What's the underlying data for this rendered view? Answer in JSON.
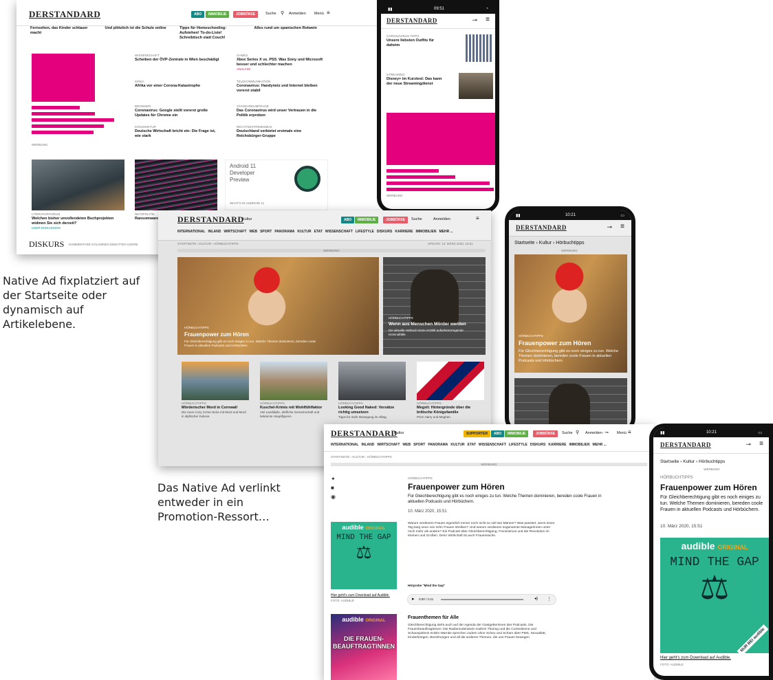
{
  "shot1": {
    "logo": "DERSTANDARD",
    "btn_abo": "ABO",
    "btn_immo": "IMMOBILIE",
    "btn_jobs": "JOBBÖRSE",
    "suche": "Suche",
    "anmelden": "Anmelden",
    "menu": "Menü",
    "top_row": [
      "Fernsehen, das Kinder schlauer macht",
      "Und plötzlich ist die Schule online",
      "Tipps für Homeschooling: Aufstehen! To-do-Liste! Schreibtisch statt Couch!",
      "Alles rund um spanischen Rotwein"
    ],
    "werbung": "WERBUNG",
    "mid_col1": [
      {
        "kicker": "WISSENSCHAFT",
        "title": "Scheiben der ÖVP-Zentrale in Wien beschädigt"
      },
      {
        "kicker": "KENIA",
        "title": "Afrika vor einer Corona-Katastrophe"
      },
      {
        "kicker": "BROWSER",
        "title": "Coronavirus: Google stellt vorerst große Updates für Chrome ein"
      },
      {
        "kicker": "KONJUNKTUR",
        "title": "Deutsche Wirtschaft bricht ein: Die Frage ist, wie stark"
      }
    ],
    "mid_col2": [
      {
        "kicker": "GAMES",
        "title": "Xbox Series X vs. PS5: Was Sony und Microsoft besser und schlechter machen",
        "extra": "ANALYSE"
      },
      {
        "kicker": "TELEKOMMUNIKATION",
        "title": "Coronavirus: Handynetz und Internet bleiben vorerst stabil"
      },
      {
        "kicker": "STANDARDUMFRAGE",
        "title": "Das Coronavirus wird unser Vertrauen in die Politik erproben"
      },
      {
        "kicker": "RECHTSEXTREMISMUS",
        "title": "Deutschland verbietet erstmals eine Reichsbürger-Gruppe"
      }
    ],
    "bottom_kicker1": "LITERATURFORUM",
    "bottom_title1": "Welchen bisher unvollendeten Buchprojekten widmen Sie sich derzeit?",
    "bottom_link1": "USER-DISKUSSION",
    "bottom_kicker2": "NETZPOLITIK",
    "bottom_title2": "Ransomware vorerst vers",
    "android_title": "Android 11 Developer Preview",
    "android_sub": "What's in Android 11",
    "diskurs": "DISKURS",
    "diskurs_links": "KOMMENTARE   KOLUMNEN   DEBATTEN   USERB"
  },
  "phone1": {
    "logo": "DERSTANDARD",
    "time": "09:51",
    "item1_kicker": "CORONAVIRUS TIPPS",
    "item1_title": "Unsere liebsten Outfits für daheim",
    "item2_kicker": "STREAMING",
    "item2_title": "Disney+ im Kurztest: Das kann der neue Streamingdienst",
    "werbung": "WERBUNG"
  },
  "caption1": "Native Ad fixplatziert auf der Startseite oder dynamisch auf Artikelebene.",
  "caption2": "Das Native Ad verlinkt entweder in ein Promotion-Ressort…",
  "shot2": {
    "logo": "DERSTANDARD",
    "section": "Kultur",
    "nav": [
      "INTERNATIONAL",
      "INLAND",
      "WIRTSCHAFT",
      "WEB",
      "SPORT",
      "PANORAMA",
      "KULTUR",
      "ETAT",
      "WISSENSCHAFT",
      "LIFESTYLE",
      "DISKURS",
      "KARRIERE",
      "IMMOBILIEN",
      "MEHR ..."
    ],
    "breadcrumb": "Startseite › Kultur › Hörbuchtipps",
    "update": "Update: 10. März 2020, 15:51",
    "werbung": "WERBUNG",
    "hero_kicker": "HÖRBUCHTIPPS",
    "hero_title": "Frauenpower zum Hören",
    "hero_text": "Für Gleichberechtigung gibt es noch einiges zu tun. Welche Themen dominieren, bereden coole Frauen in aktuellen Podcasts und Hörbüchern.",
    "side_kicker": "HÖRBUCHTIPPS",
    "side_title": "Wenn aus Menschen Mörder werden",
    "side_text": "Die aktuelle Hörbuch-Serie erzählt aufsehenerregende Kriminalfälle.",
    "cards": [
      {
        "kicker": "HÖRBUCHTIPPS",
        "title": "Mörderischer Mord in Cornwall",
        "text": "Die neue Cozy Crime-Serie mit Mord und Mord in idyllischer Kulisse."
      },
      {
        "kicker": "HÖRBUCHTIPPS",
        "title": "Kuschel-Krimis mit Wohlfühlfaktor",
        "text": "Viel Landidylle, dörfliche Gemeinschaft und bekannte Hauptfiguren."
      },
      {
        "kicker": "HÖRBUCHTIPPS",
        "title": "Looking Good Naked: Vorsätze richtig umsetzen",
        "text": "Tipps für mehr Bewegung im Alltag."
      },
      {
        "kicker": "HÖRBUCHTIPPS",
        "title": "Megxit: Hintergründe über die britische Königsfamilie",
        "text": "Prinz Harry und Meghan."
      }
    ]
  },
  "phone2": {
    "logo": "DERSTANDARD",
    "time": "10:21",
    "breadcrumb": "Startseite › Kultur › Hörbuchtipps",
    "werbung": "WERBUNG",
    "kicker": "HÖRBUCHTIPPS",
    "title": "Frauenpower zum Hören",
    "text": "Für Gleichberechtigung gibt es noch einiges zu tun. Welche Themen dominieren, bereden coole Frauen in aktuellen Podcasts und Hörbüchern."
  },
  "shot3": {
    "logo": "DERSTANDARD",
    "section": "Kultur",
    "btn_supporter": "SUPPORTER",
    "btn_abo": "ABO",
    "btn_immo": "IMMOBILIE",
    "btn_jobs": "JOBBÖRSE",
    "suche": "Suche",
    "anmelden": "Anmelden",
    "menu": "Menü",
    "nav": [
      "INTERNATIONAL",
      "INLAND",
      "WIRTSCHAFT",
      "WEB",
      "SPORT",
      "PANORAMA",
      "KULTUR",
      "ETAT",
      "WISSENSCHAFT",
      "LIFESTYLE",
      "DISKURS",
      "KARRIERE",
      "IMMOBILIEN",
      "MEHR ..."
    ],
    "breadcrumb": "Startseite › Kultur › Hörbuchtipps",
    "werbung": "WERBUNG",
    "kicker": "HÖRBUCHTIPPS",
    "title": "Frauenpower zum Hören",
    "lead": "Für Gleichberechtigung gibt es noch einiges zu tun. Welche Themen dominieren, bereden coole Frauen in aktuellen Podcasts und Hörbüchern.",
    "date": "10. März 2020, 15:51",
    "body1": "Warum verdienen Frauen eigentlich immer noch nicht so viel wie Männer? Was passiert, wenn einen Tag lang neun von zehn Frauen streiken? Und warum verdienen sogenannte Managerinnen unter noch mehr als andere? Ein Podcast über Gleichberechtigung, Feminismus und die Revolution im Kleinen und Großen. Denn Wirtschaft ist auch Frauensache.",
    "cover1_brand": "audible",
    "cover1_original": "ORIGINAL",
    "cover1_title": "MIND THE GAP",
    "link1": "Hier geht's zum Download auf Audible.",
    "link1_sub": "Foto: Audible",
    "player_label": "Hörprobe \"Mind the Gap\"",
    "player_time": "0:00 / 2:41",
    "h2": "Frauenthemen für Alle",
    "body2": "Gleichberechtigung steht auch auf der Agenda der Gastgeberinnen des Podcasts. Die Frauenbeauftragtinnen: Die Radiomoderatorin Kathrin Thüring und die Comedienne und Schauspielerin Kristin Warnke sprechen zudem ohne Scheu und Scham über PMS, Sexualität, Kinderkriegen, Beziehungen und all die anderen Themen, die uns Frauen bewegen.",
    "cover2_brand": "audible",
    "cover2_original": "ORIGINAL",
    "cover2_title": "DIE FRAUEN-BEAUFTRAGTINNEN"
  },
  "phone3": {
    "logo": "DERSTANDARD",
    "time": "10:21",
    "breadcrumb": "Startseite › Kultur › Hörbuchtipps",
    "werbung": "WERBUNG",
    "kicker": "HÖRBUCHTIPPS",
    "title": "Frauenpower zum Hören",
    "text": "Für Gleichberechtigung gibt es noch einiges zu tun. Welche Themen dominieren, bereden coole Frauen in aktuellen Podcasts und Hörbüchern.",
    "date": "10. März 2020, 15:51",
    "cover_brand": "audible",
    "cover_original": "ORIGINAL",
    "cover_title": "MIND THE GAP",
    "badge": "NUR BEI audible",
    "link": "Hier geht's zum Download auf Audible.",
    "link_sub": "Foto: Audible"
  }
}
